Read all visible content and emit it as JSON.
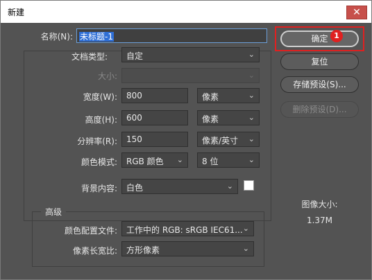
{
  "window": {
    "title": "新建",
    "close_icon": "close-icon"
  },
  "form": {
    "name": {
      "label": "名称(N):",
      "value": "未标题-1"
    },
    "preset": {
      "label": "文档类型:",
      "value": "自定"
    },
    "size": {
      "label": "大小:",
      "value": ""
    },
    "width": {
      "label": "宽度(W):",
      "value": "800",
      "unit": "像素"
    },
    "height": {
      "label": "高度(H):",
      "value": "600",
      "unit": "像素"
    },
    "resolution": {
      "label": "分辨率(R):",
      "value": "150",
      "unit": "像素/英寸"
    },
    "color_mode": {
      "label": "颜色模式:",
      "mode": "RGB 颜色",
      "bits": "8 位"
    },
    "background": {
      "label": "背景内容:",
      "value": "白色",
      "swatch_color": "#ffffff"
    },
    "advanced": {
      "title": "高级",
      "color_profile": {
        "label": "颜色配置文件:",
        "value": "工作中的 RGB:  sRGB IEC61..."
      },
      "pixel_aspect": {
        "label": "像素长宽比:",
        "value": "方形像素"
      }
    }
  },
  "buttons": {
    "ok": "确定",
    "reset": "复位",
    "save_preset": "存储预设(S)...",
    "delete_preset": "删除预设(D)..."
  },
  "annotation": {
    "badge": "1",
    "color": "#e02020"
  },
  "image_size": {
    "label": "图像大小:",
    "value": "1.37M"
  },
  "colors": {
    "dialog_bg": "#535353",
    "field_bg": "#454545",
    "selection": "#2f6fd6"
  }
}
